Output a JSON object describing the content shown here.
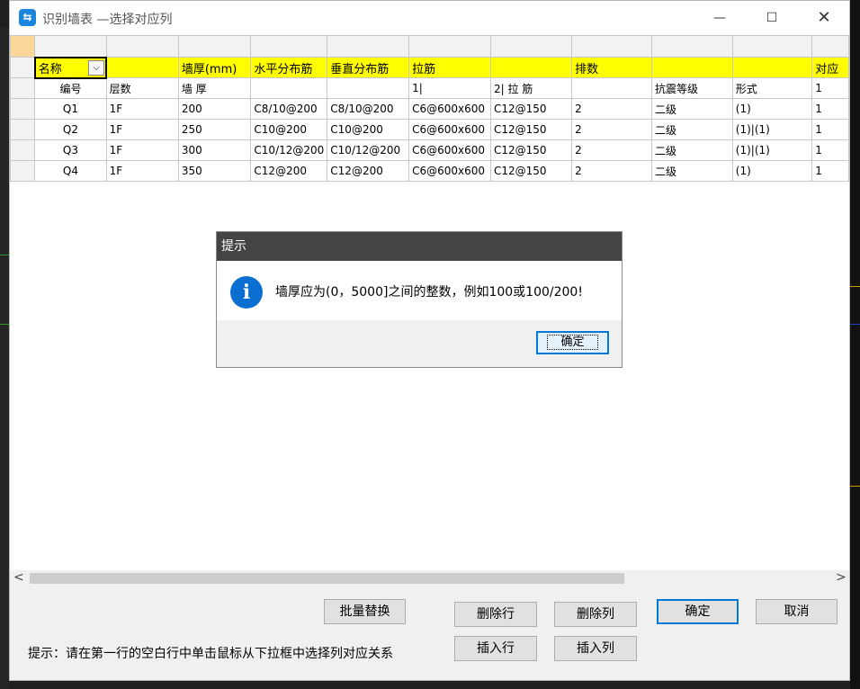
{
  "window": {
    "title": "识别墙表 —选择对应列",
    "min_glyph": "—",
    "max_glyph": "☐",
    "close_glyph": "✕",
    "icon_glyph": "⇆"
  },
  "grid": {
    "header_row": [
      "",
      "",
      "",
      "",
      "",
      "",
      "",
      "",
      "",
      "",
      "",
      ""
    ],
    "mapping_row": [
      "",
      "名称",
      "",
      "墙厚(mm)",
      "水平分布筋",
      "垂直分布筋",
      "拉筋",
      "",
      "排数",
      "",
      "",
      "对应"
    ],
    "dropdown_glyph": "⌵",
    "rows": [
      [
        "",
        "编号",
        "层数",
        "墙 厚",
        "",
        "",
        "1|",
        "2|    拉 筋",
        "",
        "抗震等级",
        "形式",
        "1"
      ],
      [
        "",
        "Q1",
        "1F",
        "200",
        "C8/10@200",
        "C8/10@200",
        "C6@600x600",
        "C12@150",
        "2",
        "二级",
        "(1)",
        "1"
      ],
      [
        "",
        "Q2",
        "1F",
        "250",
        "C10@200",
        "C10@200",
        "C6@600x600",
        "C12@150",
        "2",
        "二级",
        "(1)|(1)",
        "1"
      ],
      [
        "",
        "Q3",
        "1F",
        "300",
        "C10/12@200",
        "C10/12@200",
        "C6@600x600",
        "C12@150",
        "2",
        "二级",
        "(1)|(1)",
        "1"
      ],
      [
        "",
        "Q4",
        "1F",
        "350",
        "C12@200",
        "C12@200",
        "C6@600x600",
        "C12@150",
        "2",
        "二级",
        "(1)",
        "1"
      ]
    ]
  },
  "scroll": {
    "left_glyph": "<",
    "right_glyph": ">"
  },
  "buttons": {
    "batch_replace": "批量替换",
    "delete_row": "删除行",
    "delete_col": "删除列",
    "ok": "确定",
    "cancel": "取消",
    "insert_row": "插入行",
    "insert_col": "插入列"
  },
  "hint": "提示：请在第一行的空白行中单击鼠标从下拉框中选择列对应关系",
  "modal": {
    "title": "提示",
    "icon_glyph": "i",
    "message": "墙厚应为(0，5000]之间的整数，例如100或100/200!",
    "ok": "确定"
  },
  "colors": {
    "mapping_row": "#ffff00",
    "modal_title": "#444444",
    "accent": "#0078d7"
  }
}
